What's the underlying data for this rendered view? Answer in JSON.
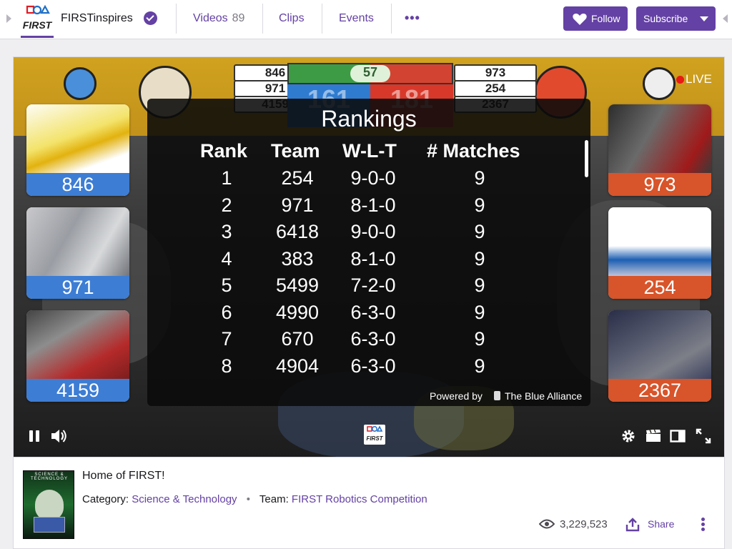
{
  "header": {
    "channel_name": "FIRSTinspires",
    "tabs": [
      {
        "label": "Videos",
        "count": "89"
      },
      {
        "label": "Clips"
      },
      {
        "label": "Events"
      }
    ],
    "follow_label": "Follow",
    "subscribe_label": "Subscribe"
  },
  "player": {
    "live_label": "LIVE",
    "timer": "57",
    "blue_scores": [
      "846",
      "971",
      "4159"
    ],
    "red_scores": [
      "973",
      "254",
      "2367"
    ],
    "blue_alliance_score": "161",
    "red_alliance_score": "181",
    "blue_robots": [
      "846",
      "971",
      "4159"
    ],
    "red_robots": [
      "973",
      "254",
      "2367"
    ],
    "rankings": {
      "title": "Rankings",
      "columns": [
        "Rank",
        "Team",
        "W-L-T",
        "# Matches"
      ],
      "rows": [
        [
          "1",
          "254",
          "9-0-0",
          "9"
        ],
        [
          "2",
          "971",
          "8-1-0",
          "9"
        ],
        [
          "3",
          "6418",
          "9-0-0",
          "9"
        ],
        [
          "4",
          "383",
          "8-1-0",
          "9"
        ],
        [
          "5",
          "5499",
          "7-2-0",
          "9"
        ],
        [
          "6",
          "4990",
          "6-3-0",
          "9"
        ],
        [
          "7",
          "670",
          "6-3-0",
          "9"
        ],
        [
          "8",
          "4904",
          "6-3-0",
          "9"
        ]
      ],
      "powered_by": "Powered by",
      "powered_name": "The Blue Alliance"
    }
  },
  "info": {
    "title": "Home of FIRST!",
    "category_label": "Category:",
    "category_value": "Science & Technology",
    "team_label": "Team:",
    "team_value": "FIRST Robotics Competition",
    "views": "3,229,523",
    "share_label": "Share",
    "box_art_text": "SCIENCE & TECHNOLOGY"
  },
  "colors": {
    "brand": "#6441a4",
    "blue_alliance": "#3d7dd4",
    "red_alliance": "#d8542a",
    "live": "#e91916"
  },
  "icons": [
    "first-logo",
    "verified-icon",
    "more-icon",
    "heart-icon",
    "chevron-down-icon",
    "pause-icon",
    "volume-icon",
    "settings-icon",
    "clip-icon",
    "theater-mode-icon",
    "fullscreen-icon",
    "eye-icon",
    "share-icon",
    "kebab-icon"
  ]
}
